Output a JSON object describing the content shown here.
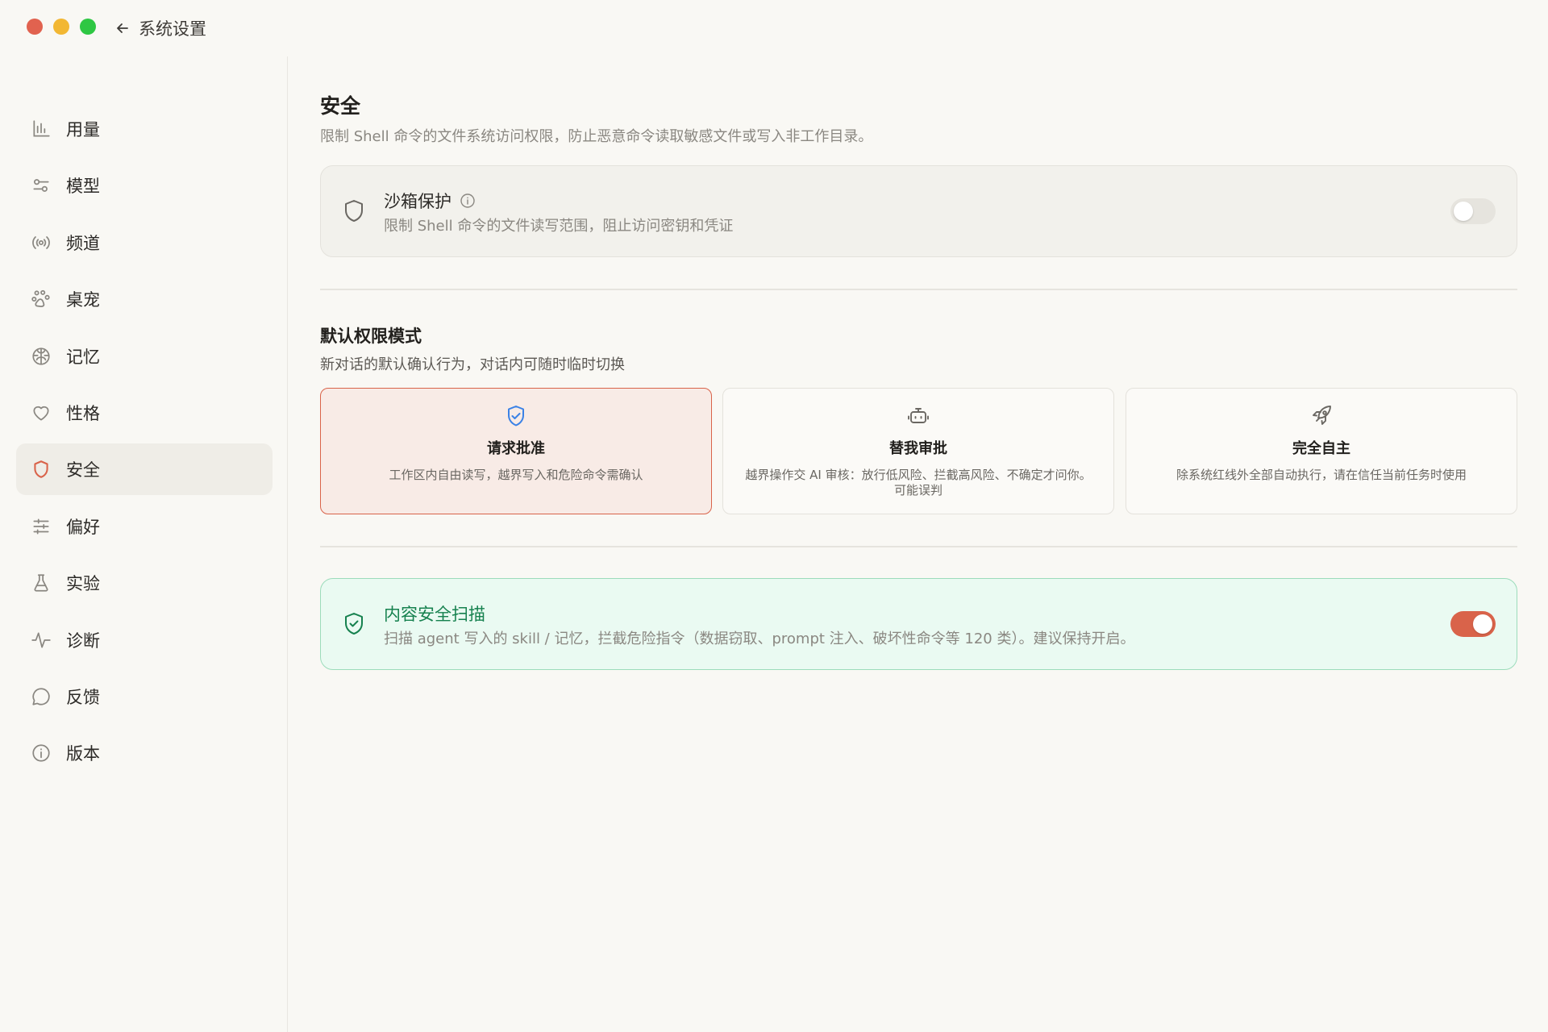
{
  "titlebar": {
    "back_label": "系统设置"
  },
  "sidebar": {
    "items": [
      {
        "label": "用量",
        "icon": "bar-chart-icon",
        "active": false
      },
      {
        "label": "模型",
        "icon": "sliders-icon",
        "active": false
      },
      {
        "label": "频道",
        "icon": "broadcast-icon",
        "active": false
      },
      {
        "label": "桌宠",
        "icon": "paw-icon",
        "active": false
      },
      {
        "label": "记忆",
        "icon": "brain-icon",
        "active": false
      },
      {
        "label": "性格",
        "icon": "heart-icon",
        "active": false
      },
      {
        "label": "安全",
        "icon": "shield-icon",
        "active": true
      },
      {
        "label": "偏好",
        "icon": "settings-sliders-icon",
        "active": false
      },
      {
        "label": "实验",
        "icon": "flask-icon",
        "active": false
      },
      {
        "label": "诊断",
        "icon": "pulse-icon",
        "active": false
      },
      {
        "label": "反馈",
        "icon": "chat-bubble-icon",
        "active": false
      },
      {
        "label": "版本",
        "icon": "info-icon",
        "active": false
      }
    ]
  },
  "main": {
    "title": "安全",
    "subtitle": "限制 Shell 命令的文件系统访问权限，防止恶意命令读取敏感文件或写入非工作目录。",
    "sandbox": {
      "title": "沙箱保护",
      "description": "限制 Shell 命令的文件读写范围，阻止访问密钥和凭证",
      "enabled": false
    },
    "permission": {
      "title": "默认权限模式",
      "subtitle": "新对话的默认确认行为，对话内可随时临时切换",
      "modes": [
        {
          "title": "请求批准",
          "description": "工作区内自由读写，越界写入和危险命令需确认",
          "icon": "shield-check-icon",
          "selected": true
        },
        {
          "title": "替我审批",
          "description": "越界操作交 AI 审核：放行低风险、拦截高风险、不确定才问你。可能误判",
          "icon": "robot-icon",
          "selected": false
        },
        {
          "title": "完全自主",
          "description": "除系统红线外全部自动执行，请在信任当前任务时使用",
          "icon": "rocket-icon",
          "selected": false
        }
      ]
    },
    "scan": {
      "title": "内容安全扫描",
      "description": "扫描 agent 写入的 skill / 记忆，拦截危险指令（数据窃取、prompt 注入、破坏性命令等 120 类）。建议保持开启。",
      "enabled": true
    }
  },
  "colors": {
    "accent": "#d9634a",
    "success": "#16814f",
    "selected_bg": "#f8ebe6",
    "scan_bg": "#eafaf2",
    "info_blue": "#3b82e6"
  }
}
